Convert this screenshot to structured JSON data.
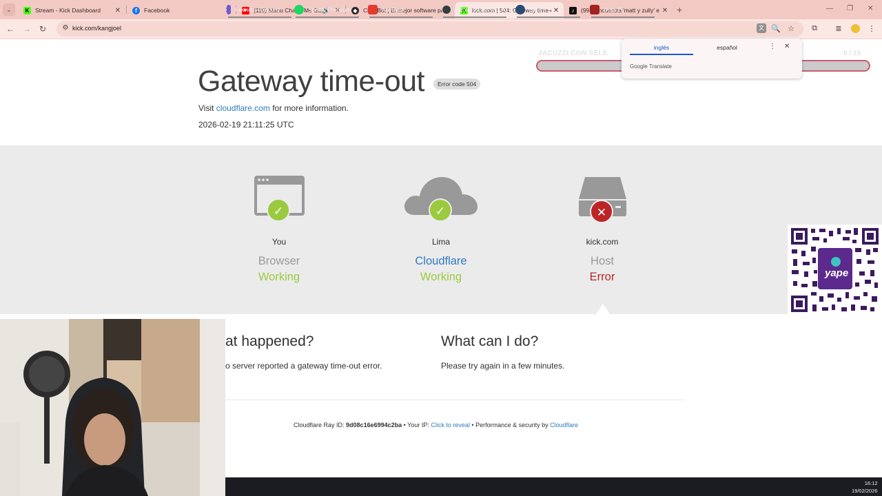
{
  "browser": {
    "tabs": [
      {
        "title": "Stream - Kick Dashboard",
        "favicon": "kick-icon",
        "active": false
      },
      {
        "title": "Facebook",
        "favicon": "facebook-icon",
        "active": false
      },
      {
        "title": "(110) Manu Chao - Me Gus",
        "favicon": "youtube-icon",
        "active": false
      },
      {
        "title": "Chat Bot | El mejor software pa",
        "favicon": "chatbot-icon",
        "active": false
      },
      {
        "title": "kick.com | 504: Gateway time-o",
        "favicon": "kick-icon",
        "active": true
      },
      {
        "title": "(99+)Encuentra 'matt y zully' e",
        "favicon": "tiktok-icon",
        "active": false
      }
    ],
    "url": "kick.com/kangjoel",
    "new_tab": "+"
  },
  "translate_popup": {
    "tab_source": "inglés",
    "tab_target": "español",
    "brand": "Google Translate"
  },
  "overlay": {
    "ticker_text": "JACUZZI CON SELE",
    "counter_text": "0 / 15",
    "qr_label": "yape"
  },
  "error": {
    "title": "Gateway time-out",
    "code_badge": "Error code 504",
    "visit_prefix": "Visit",
    "visit_link": "cloudflare.com",
    "visit_suffix": "for more information.",
    "timestamp": "2026-02-19 21:11:25 UTC"
  },
  "nodes": [
    {
      "name": "You",
      "kind": "Browser",
      "status": "Working",
      "status_type": "ok"
    },
    {
      "name": "Lima",
      "kind": "Cloudflare",
      "status": "Working",
      "status_type": "ok"
    },
    {
      "name": "kick.com",
      "kind": "Host",
      "status": "Error",
      "status_type": "error"
    }
  ],
  "what_happened": {
    "heading": "at happened?",
    "text": "o server reported a gateway time-out error."
  },
  "what_can_i_do": {
    "heading": "What can I do?",
    "text": "Please try again in a few minutes."
  },
  "footer": {
    "ray_label": "Cloudflare Ray ID:",
    "ray_id": "9d08c16e6994c2ba",
    "bullet": "•",
    "ip_label": "Your IP:",
    "ip_link": "Click to reveal",
    "perf_label": "Performance & security by",
    "perf_link": "Cloudflare"
  },
  "taskbar": {
    "apps": [
      {
        "label": "Friends - Discord",
        "icon": "discord-icon"
      },
      {
        "label": "Spotify Premium",
        "icon": "spotify-icon"
      },
      {
        "label": "AnyDesk",
        "icon": "anydesk-icon"
      },
      {
        "label": "OBS 30.0.2 (MODO ...",
        "icon": "obs-icon"
      },
      {
        "label": "Steam",
        "icon": "steam-icon"
      },
      {
        "label": "Dota 2",
        "icon": "dota-icon"
      }
    ],
    "time": "16:12",
    "date": "19/02/2026"
  },
  "colors": {
    "ok": "#9bca3e",
    "error": "#bd2426",
    "link": "#2f7bbf",
    "tabbar": "#f3c9c4"
  }
}
